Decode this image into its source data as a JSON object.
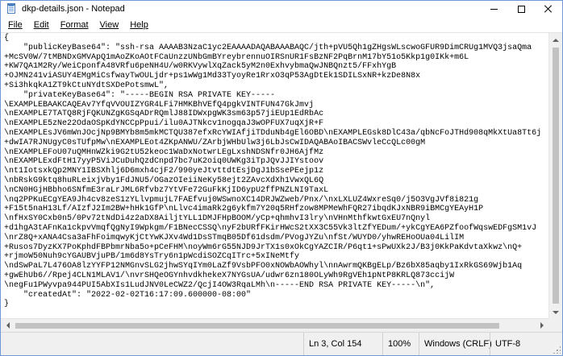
{
  "window": {
    "title": "dkp-details.json - Notepad",
    "accent_color": "#6d9ad6",
    "icon": "notepad-icon"
  },
  "menu": {
    "items": [
      {
        "label": "File"
      },
      {
        "label": "Edit"
      },
      {
        "label": "Format"
      },
      {
        "label": "View"
      },
      {
        "label": "Help"
      }
    ]
  },
  "document": {
    "lines": [
      "{",
      "    \"publicKeyBase64\": \"ssh-rsa AAAAB3NzaC1yc2EAAAADAQABAAABAQC/jth+pVU5Qh1gZHgsWLscwoGFUR9DimCRUg1MVQ3jsaQma",
      "+McSV0W/7tMBNDxGMVApQ1mAoZKoAOtFCaUnzzUNbGmBYreybrennuOIRSnUR1FsBzNF2PqBrnM17bY51o5Kkp1g0IKk+m6L",
      "+KW7QA1M2Ry/WeiCponfA48VRfu6peNH4U/w0RKVywlXqZack5yM2n0ExhvybmaQwJNBQnzt5/FFxhYgB",
      "+OJMN241viASUY4EMgMiCsfwayTwOULjdr+ps1wWg1Md33TyoyRe1RrxO3qP53AgDtEk1SDILSxNR+kzDe8N8x",
      "+Si3hkqkA1ZT9kCtuNYdtSXDePotsmwL\",",
      "    \"privateKeyBase64\": \"-----BEGIN RSA PRIVATE KEY-----",
      "\\EXAMPLEBAAKCAQEAv7YfqVVOUIZYGR4LFi7HMKBhVEfQ4pgkVINTFUN47GkJmvj",
      "\\nEXAMPLE7TATQ8RjFQKUNZgKGSqADrRQmlJ88IDWxpgWK3sm63p57jiEUp1EdRbAc",
      "\\nEXAMPLE5zNe22OdaOSpKdYNCCpPpui/ilu0AJTNkcv1nogqaJ3wOPFUX7uqXjR+F",
      "\\nEXAMPLEsJV6mWnJOcjNp9BMYb8m5mkMCTQU387efxRcYWIAfjiTDduNb4gEl6OBD\\nEXAMPLEGsk8DlC43a/qbNcFoJTHd908qMkXtUa8Tt6j",
      "+dwIA7RJNUgyC0sTUfpMw\\nEXAMPLEot4ZKpANWU/ZArbjWHbUlw3j6LbJsCwIDAQABAoIBACSWvleCcQLc00gM",
      "\\nEXAMPLEFoU07uQMHnWZki9G2tU52keoc1WaDxNotwrLEgLxshNDSNfr0JH6AjfMz",
      "\\nEXAMPLExdFtH17yyP5ViJCuDuhQzdCnpd7bc7uK2oiq0UWKg3iTpJQvJJIYstoov",
      "\\nt1IotsxkQp2MNY1IBSXhlj6D6mxh4cjF2/990yeJtvttdtEsjDgJ1bSsePEejp1z",
      "\\nbRskG9ktq8huRLeixjVby1FdJNU5/OGazOIeiiNeKy58ejt2ZAvcXdXh1VwxQL6Q",
      "\\nCN0HGjHBbho6SNfmE3raLrJML6Rfvbz7YtVFe72GuFkKjID6ypU2ffPNZLNI9TaxL",
      "\\nq2PPKuECgYEA9Jh4cv8zeS1zYLlvpmujL7FAEfvuj0WSwnoXC14DRJWZweb/Pnx/\\nxLXLUZ4WxreSq0/j5O3VgJVf8i821g",
      "+F15t5naH13Lf/AIzfJ2Im2BW+hHk1GfP\\nLlvc4imaRk2g6ykfm7Y20q5RHfzow8MPMeWhFQR27ibqdKJxNBR9iBMCgYEAyH1P",
      "\\nfHxSY0Cxb0n5/0Pv72tNdDi4z2aDX8AiljtYLL1DMJFHpBOOM/yCp+qhmhvI3lry\\nVHnMthfkwtGxEU7nQnyl",
      "+d1hgA3tAFnKa1ckpvVmqfQgNyI9Wpkgm/F1BNecCSSQ\\nyF2bURfFKirHWcS2tXX3C55Vk3ltZfYEDum/+ykCgYEA6PZfoofWqswEDFgSM1vJ",
      "\\nrZ8Q+xANA4Csa3aFhFoimqwyKjCtYwKJXv4Wd1DsSTmqB05Df61dsdm/PVogJYZu\\nfSt/WUYD0/yhwREHoOUa04LilIM",
      "+Rusos7DyzKX7PoKphdFBPbmrNba5o+pCeFHM\\noyWm6rG55NJD9JrTX1s0xOkCgYAZCIR/P6qt1+sPwUXk2J/B3j0KkPaKdvtaXkwz\\nQ+",
      "+rjmoW50Nuh9cYGAUBVjuPB/1m6d8YsTry6n1pWcdiSOZCqITrc+5xINeMtfy",
      "\\ndSwPaL7L476OA8lzYYFP12NMGnvSLG2jhwSYqIYm0LaZf9VsbPFO0xNOWbAOWhyl\\nnAwrmQKBgELp/Bz6bX85aqby1IxRkGS69Wjb1Aq",
      "+gwEhUb6//Rpej4CLN1MLAV1/\\nvrSHQeOGYnhvdkhekeX7NYGsUA/udwr6zn180OLyWh9RgVEh1pNtP8KRLQ873ccijW",
      "\\negFu1PWyvpa944PUI5AbXIs1LudJNV0LeCWZ2/QcjI4OW3RqaLMh\\n-----END RSA PRIVATE KEY-----\\n\",",
      "    \"createdAt\": \"2022-02-02T16:17:09.600000-08:00\"",
      "}"
    ]
  },
  "status": {
    "position": "Ln 3, Col 154",
    "zoom": "100%",
    "line_ending": "Windows (CRLF)",
    "encoding": "UTF-8"
  }
}
